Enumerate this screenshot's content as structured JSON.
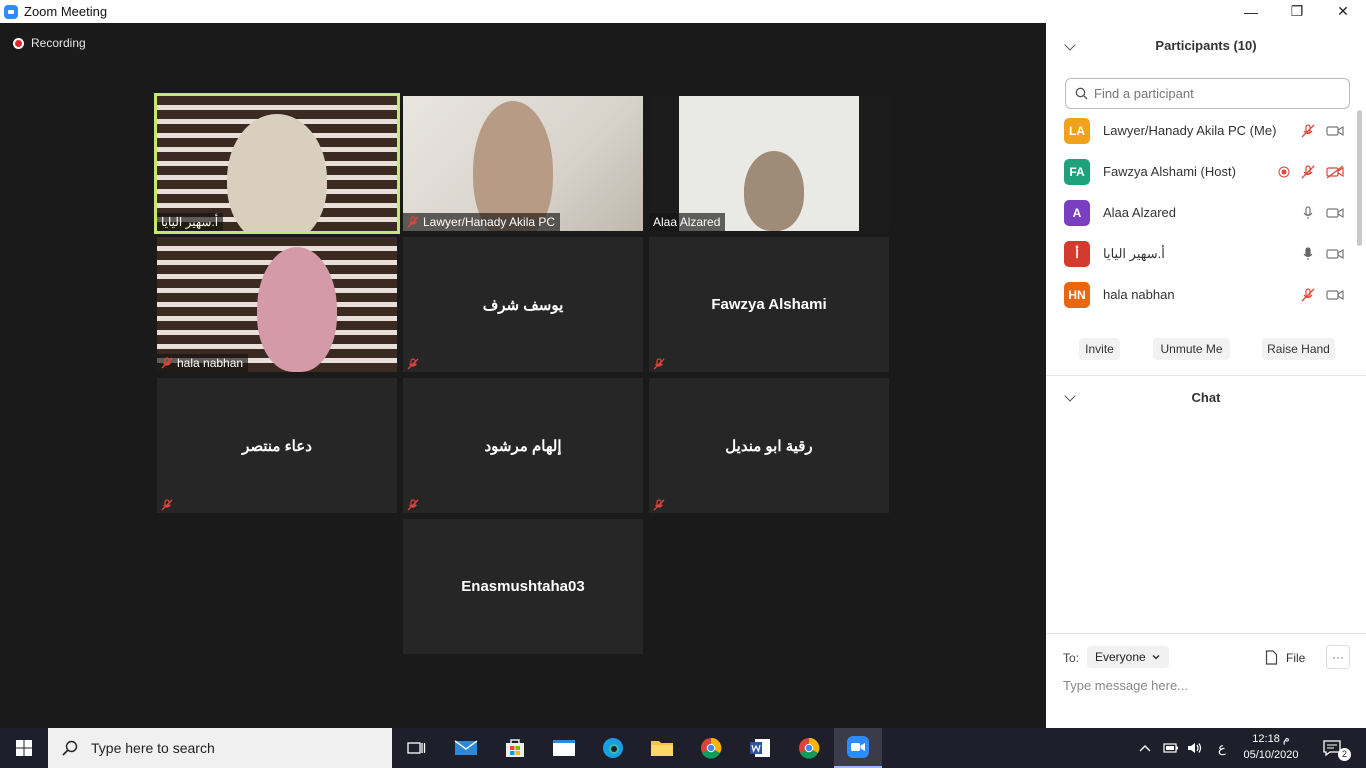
{
  "window": {
    "title": "Zoom Meeting",
    "minimize": "—",
    "restore": "❐",
    "close": "✕"
  },
  "meeting": {
    "recording_label": "Recording",
    "tiles": [
      {
        "name": "أ.سهير اليايا",
        "video": true,
        "active": true
      },
      {
        "name": "Lawyer/Hanady Akila PC",
        "video": true
      },
      {
        "name": "Alaa Alzared",
        "video": true
      },
      {
        "name": "hala nabhan",
        "video": true
      },
      {
        "name": "يوسف شرف",
        "video": false
      },
      {
        "name": "Fawzya Alshami",
        "video": false
      },
      {
        "name": "دعاء منتصر",
        "video": false
      },
      {
        "name": "إلهام مرشود",
        "video": false
      },
      {
        "name": "رقية ابو منديل",
        "video": false
      },
      {
        "name": "Enasmushtaha03",
        "video": false
      }
    ]
  },
  "participants_panel": {
    "title": "Participants (10)",
    "search_placeholder": "Find a participant",
    "participants": [
      {
        "initials": "LA",
        "name": "Lawyer/Hanady Akila PC (Me)",
        "color": "#f0a21c",
        "audio": "muted",
        "video": "on"
      },
      {
        "initials": "FA",
        "name": "Fawzya Alshami (Host)",
        "color": "#1ea27c",
        "recording": true,
        "audio": "muted",
        "video": "off"
      },
      {
        "initials": "A",
        "name": "Alaa Alzared",
        "color": "#7a3fc0",
        "audio": "on",
        "video": "on"
      },
      {
        "initials": "أ",
        "name": "أ.سهير اليايا",
        "color": "#d43b2f",
        "audio": "speaking",
        "video": "on"
      },
      {
        "initials": "HN",
        "name": "hala nabhan",
        "color": "#e8660f",
        "audio": "muted",
        "video": "on"
      }
    ],
    "buttons": {
      "invite": "Invite",
      "unmute": "Unmute Me",
      "raise_hand": "Raise Hand"
    }
  },
  "chat": {
    "title": "Chat",
    "to_label": "To:",
    "recipient": "Everyone",
    "file_label": "File",
    "more_label": "···",
    "input_placeholder": "Type message here..."
  },
  "taskbar": {
    "search_placeholder": "Type here to search",
    "time": "م 12:18",
    "date": "05/10/2020",
    "lang": "ع",
    "notifications": "2"
  },
  "colors": {
    "active_speaker": "#c8e86a",
    "mute_red": "#e0453a",
    "zoom_blue": "#2d8cff"
  }
}
